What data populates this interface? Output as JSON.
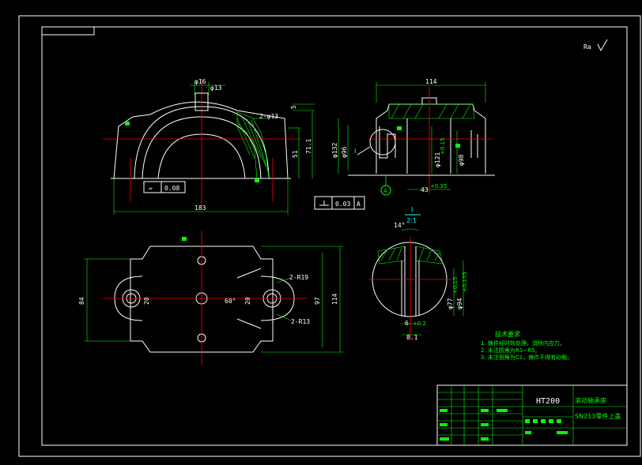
{
  "colors": {
    "background": "#000000",
    "outline": "#ffffff",
    "dimension": "#00ff00",
    "centerline": "#ff0000",
    "hatch": "#00ff00",
    "accent": "#00ffff"
  },
  "front_view": {
    "dims": {
      "d_top_outer": "φ16",
      "d_top_inner": "φ13",
      "d_holes": "2-φ13",
      "width": "183",
      "height1": "51",
      "height2": "71.1",
      "top_offset": "5"
    },
    "tolerance_frame": {
      "symbol": "▱",
      "value": "0.08"
    }
  },
  "flatness_box": {
    "value": "0.03",
    "datum": "A"
  },
  "side_view": {
    "dims": {
      "overall": "114",
      "d132": "φ132",
      "d96": "φ96",
      "d121": "φ121",
      "d121_tol": "+0.15",
      "d98": "φ98",
      "width43": "43",
      "width43_tol": "+0.35",
      "detail_label": "I",
      "datum": "A"
    }
  },
  "top_view": {
    "dims": {
      "width84": "84",
      "width97": "97",
      "width114": "114",
      "w20a": "20",
      "w20b": "20",
      "angle": "60°",
      "r19": "2-R19",
      "r13": "2-R13"
    }
  },
  "detail_view": {
    "title": "I",
    "scale": "2:1",
    "dims": {
      "angle": "14°",
      "d77": "φ77",
      "d77_tol": "+0.15",
      "d94": "φ94",
      "d94_tol": "+0.175",
      "w6": "6",
      "w6_tol": "+0.2",
      "w81": "8.1"
    }
  },
  "technical_requirements": {
    "title": "技术要求",
    "items": [
      "1. 铸件经时效处理，消除内应力。",
      "2. 未注圆角为R3~R5。",
      "3. 未注倒角为C1，铸件不得有砂眼。"
    ]
  },
  "roughness_note": "Ra",
  "title_block": {
    "material": "HT200",
    "name_line1": "滚动轴承座",
    "name_line2": "SN213零件上盖"
  }
}
